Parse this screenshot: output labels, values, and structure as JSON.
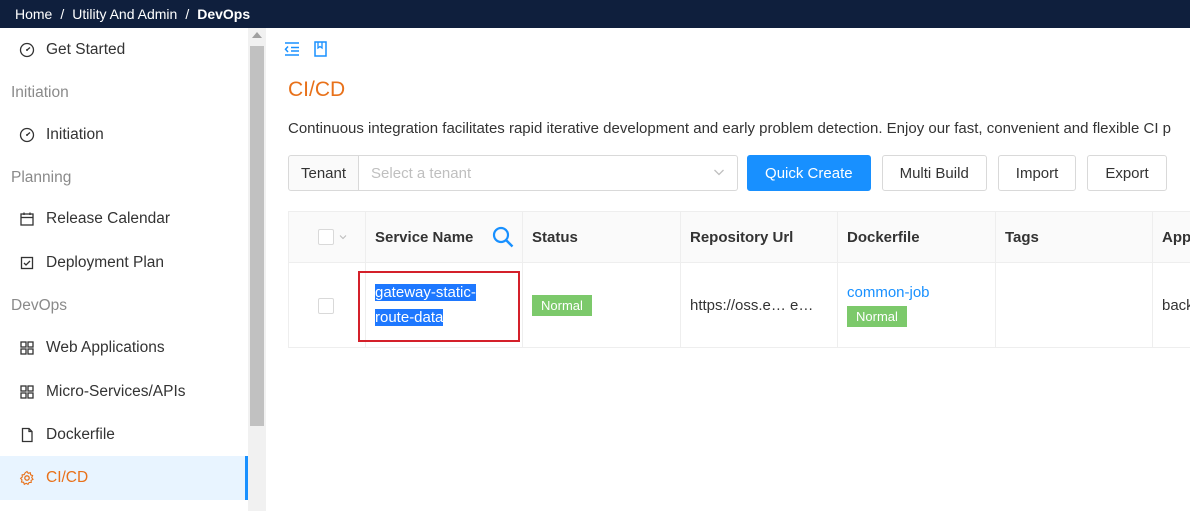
{
  "breadcrumb": {
    "home": "Home",
    "section": "Utility And Admin",
    "current": "DevOps",
    "separator": "/"
  },
  "sidebar": {
    "get_started": "Get Started",
    "group_initiation": "Initiation",
    "initiation": "Initiation",
    "group_planning": "Planning",
    "release_calendar": "Release Calendar",
    "deployment_plan": "Deployment Plan",
    "group_devops": "DevOps",
    "web_applications": "Web Applications",
    "micro_services": "Micro-Services/APIs",
    "dockerfile": "Dockerfile",
    "cicd": "CI/CD"
  },
  "page": {
    "title": "CI/CD",
    "description": "Continuous integration facilitates rapid iterative development and early problem detection. Enjoy our fast, convenient and flexible CI p"
  },
  "toolbar": {
    "tenant_label": "Tenant",
    "tenant_placeholder": "Select a tenant",
    "quick_create": "Quick Create",
    "multi_build": "Multi Build",
    "import": "Import",
    "export": "Export"
  },
  "table": {
    "headers": {
      "service_name": "Service Name",
      "status": "Status",
      "repository_url": "Repository Url",
      "dockerfile": "Dockerfile",
      "tags": "Tags",
      "app": "App"
    },
    "rows": [
      {
        "service_name_line1": "gateway-static-",
        "service_name_line2": "route-data",
        "status": "Normal",
        "repository_url": "https://oss.e…   e…",
        "dockerfile_name": "common-job",
        "dockerfile_status": "Normal",
        "tags": "",
        "app": "back"
      }
    ]
  },
  "colors": {
    "accent": "#e8711a",
    "primary": "#1890ff",
    "topbar": "#0f1f3d",
    "status_normal": "#7cc96b",
    "highlight_box": "#d4202a"
  },
  "icons": {
    "get_started": "dashboard-gauge-icon",
    "initiation": "dashboard-gauge-icon",
    "release_calendar": "calendar-icon",
    "deployment_plan": "checklist-icon",
    "web_applications": "apps-grid-icon",
    "micro_services": "apps-grid-icon",
    "dockerfile": "document-icon",
    "cicd": "gear-icon",
    "search": "search-icon"
  }
}
